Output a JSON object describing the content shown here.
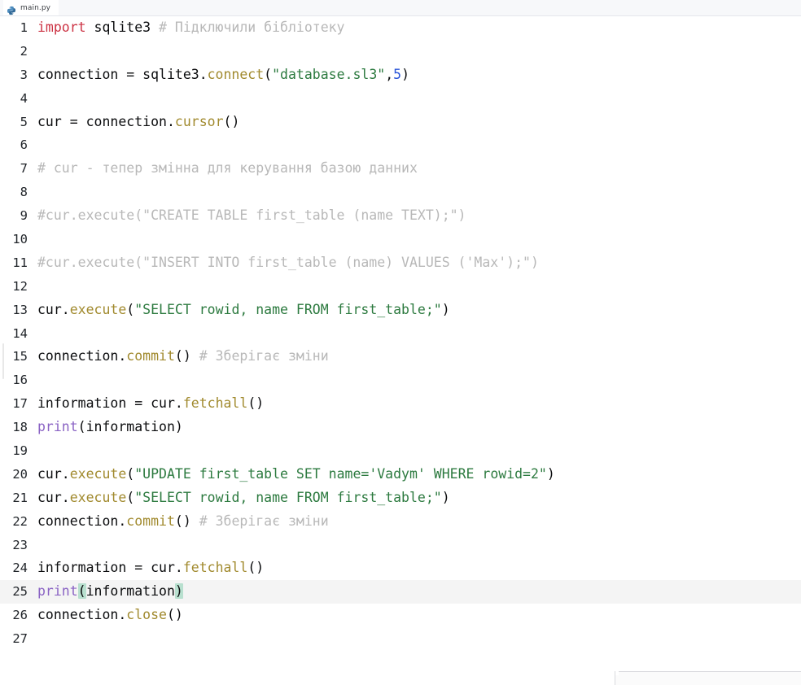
{
  "window": {
    "app": "code-editor",
    "background": "#ffffff"
  },
  "tabbar": {
    "tabs": [
      {
        "label": "main.py",
        "icon": "python-file-icon",
        "active": true
      }
    ]
  },
  "colors": {
    "keyword": "#cc3344",
    "comment": "#b8b8b8",
    "function": "#a18a2e",
    "string": "#2c7a3f",
    "number": "#2a55d8",
    "builtin": "#8a63c4",
    "plain": "#0b0c0e",
    "current_line_bg": "#f4f4f4",
    "bracket_match_bg": "#b8e0cf",
    "gutter_text": "#1f2328"
  },
  "editor": {
    "language": "Python",
    "current_line": 25,
    "total_lines": 27,
    "lines": [
      {
        "n": "1",
        "tokens": [
          {
            "t": "import",
            "c": "kw"
          },
          {
            "t": " sqlite3 ",
            "c": "plain"
          },
          {
            "t": "# Підключили бібліотеку",
            "c": "comment"
          }
        ]
      },
      {
        "n": "2",
        "tokens": []
      },
      {
        "n": "3",
        "tokens": [
          {
            "t": "connection ",
            "c": "plain"
          },
          {
            "t": "=",
            "c": "plain"
          },
          {
            "t": " sqlite3.",
            "c": "plain"
          },
          {
            "t": "connect",
            "c": "fn"
          },
          {
            "t": "(",
            "c": "punct"
          },
          {
            "t": "\"database.sl3\"",
            "c": "str"
          },
          {
            "t": ",",
            "c": "punct"
          },
          {
            "t": "5",
            "c": "num"
          },
          {
            "t": ")",
            "c": "punct"
          }
        ]
      },
      {
        "n": "4",
        "tokens": []
      },
      {
        "n": "5",
        "tokens": [
          {
            "t": "cur ",
            "c": "plain"
          },
          {
            "t": "=",
            "c": "plain"
          },
          {
            "t": " connection.",
            "c": "plain"
          },
          {
            "t": "cursor",
            "c": "fn"
          },
          {
            "t": "()",
            "c": "punct"
          }
        ]
      },
      {
        "n": "6",
        "tokens": []
      },
      {
        "n": "7",
        "tokens": [
          {
            "t": "# cur - тепер змінна для керування базою данних",
            "c": "comment"
          }
        ]
      },
      {
        "n": "8",
        "tokens": []
      },
      {
        "n": "9",
        "tokens": [
          {
            "t": "#cur.execute(\"CREATE TABLE first_table (name TEXT);\")",
            "c": "comment"
          }
        ]
      },
      {
        "n": "10",
        "tokens": []
      },
      {
        "n": "11",
        "tokens": [
          {
            "t": "#cur.execute(\"INSERT INTO first_table (name) VALUES ('Max');\")",
            "c": "comment"
          }
        ]
      },
      {
        "n": "12",
        "tokens": []
      },
      {
        "n": "13",
        "tokens": [
          {
            "t": "cur.",
            "c": "plain"
          },
          {
            "t": "execute",
            "c": "fn"
          },
          {
            "t": "(",
            "c": "punct"
          },
          {
            "t": "\"SELECT rowid, name FROM first_table;\"",
            "c": "str"
          },
          {
            "t": ")",
            "c": "punct"
          }
        ]
      },
      {
        "n": "14",
        "tokens": []
      },
      {
        "n": "15",
        "tokens": [
          {
            "t": "connection.",
            "c": "plain"
          },
          {
            "t": "commit",
            "c": "fn"
          },
          {
            "t": "() ",
            "c": "punct"
          },
          {
            "t": "# Зберігає зміни",
            "c": "comment"
          }
        ]
      },
      {
        "n": "16",
        "tokens": []
      },
      {
        "n": "17",
        "tokens": [
          {
            "t": "information ",
            "c": "plain"
          },
          {
            "t": "=",
            "c": "plain"
          },
          {
            "t": " cur.",
            "c": "plain"
          },
          {
            "t": "fetchall",
            "c": "fn"
          },
          {
            "t": "()",
            "c": "punct"
          }
        ]
      },
      {
        "n": "18",
        "tokens": [
          {
            "t": "print",
            "c": "builtin"
          },
          {
            "t": "(information)",
            "c": "punct"
          }
        ]
      },
      {
        "n": "19",
        "tokens": []
      },
      {
        "n": "20",
        "tokens": [
          {
            "t": "cur.",
            "c": "plain"
          },
          {
            "t": "execute",
            "c": "fn"
          },
          {
            "t": "(",
            "c": "punct"
          },
          {
            "t": "\"UPDATE first_table SET name='Vadym' WHERE rowid=2\"",
            "c": "str"
          },
          {
            "t": ")",
            "c": "punct"
          }
        ]
      },
      {
        "n": "21",
        "tokens": [
          {
            "t": "cur.",
            "c": "plain"
          },
          {
            "t": "execute",
            "c": "fn"
          },
          {
            "t": "(",
            "c": "punct"
          },
          {
            "t": "\"SELECT rowid, name FROM first_table;\"",
            "c": "str"
          },
          {
            "t": ")",
            "c": "punct"
          }
        ]
      },
      {
        "n": "22",
        "tokens": [
          {
            "t": "connection.",
            "c": "plain"
          },
          {
            "t": "commit",
            "c": "fn"
          },
          {
            "t": "() ",
            "c": "punct"
          },
          {
            "t": "# Зберігає зміни",
            "c": "comment"
          }
        ]
      },
      {
        "n": "23",
        "tokens": []
      },
      {
        "n": "24",
        "tokens": [
          {
            "t": "information ",
            "c": "plain"
          },
          {
            "t": "=",
            "c": "plain"
          },
          {
            "t": " cur.",
            "c": "plain"
          },
          {
            "t": "fetchall",
            "c": "fn"
          },
          {
            "t": "()",
            "c": "punct"
          }
        ]
      },
      {
        "n": "25",
        "current": true,
        "tokens": [
          {
            "t": "print",
            "c": "builtin"
          },
          {
            "t": "(",
            "c": "punct",
            "match": true
          },
          {
            "t": "information",
            "c": "plain"
          },
          {
            "t": ")",
            "c": "punct",
            "match": true
          }
        ]
      },
      {
        "n": "26",
        "tokens": [
          {
            "t": "connection.",
            "c": "plain"
          },
          {
            "t": "close",
            "c": "fn"
          },
          {
            "t": "()",
            "c": "punct"
          }
        ]
      },
      {
        "n": "27",
        "tokens": []
      }
    ]
  }
}
